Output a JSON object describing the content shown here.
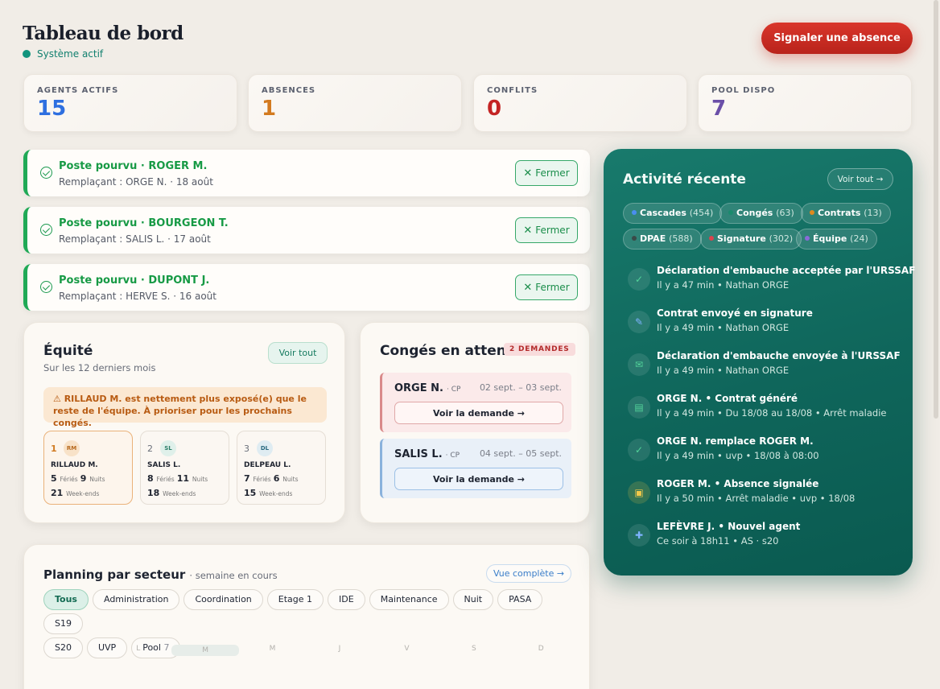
{
  "header": {
    "title": "Tableau de bord",
    "status": "Système actif",
    "report_button": "Signaler une absence"
  },
  "kpis": [
    {
      "label": "AGENTS ACTIFS",
      "value": "15",
      "color": "#2e6fe0"
    },
    {
      "label": "ABSENCES",
      "value": "1",
      "color": "#d37a1f"
    },
    {
      "label": "CONFLITS",
      "value": "0",
      "color": "#c42424"
    },
    {
      "label": "POOL DISPO",
      "value": "7",
      "color": "#6b4fa8"
    }
  ],
  "notifications": [
    {
      "title": "Poste pourvu · ROGER M.",
      "subtitle": "Remplaçant : ORGE N. · 18 août",
      "close": "Fermer"
    },
    {
      "title": "Poste pourvu · BOURGEON T.",
      "subtitle": "Remplaçant : SALIS L. · 17 août",
      "close": "Fermer"
    },
    {
      "title": "Poste pourvu · DUPONT J.",
      "subtitle": "Remplaçant : HERVE S. · 16 août",
      "close": "Fermer"
    }
  ],
  "equity": {
    "title": "Équité",
    "subtitle": "Sur les 12 derniers mois",
    "see_all": "Voir tout",
    "warning": "RILLAUD M. est nettement plus exposé(e) que le reste de l'équipe. À prioriser pour les prochains congés.",
    "labels": {
      "feries": "Fériés",
      "nuits": "Nuits",
      "weekends": "Week-ends"
    },
    "agents": [
      {
        "rank": "1",
        "initials": "RM",
        "name": "RILLAUD M.",
        "feries": "5",
        "nuits": "9",
        "weekends": "21"
      },
      {
        "rank": "2",
        "initials": "SL",
        "name": "SALIS L.",
        "feries": "8",
        "nuits": "11",
        "weekends": "18"
      },
      {
        "rank": "3",
        "initials": "DL",
        "name": "DELPEAU L.",
        "feries": "7",
        "nuits": "6",
        "weekends": "15"
      }
    ]
  },
  "leaves": {
    "title": "Congés en attente",
    "badge": "2 DEMANDES",
    "items": [
      {
        "name": "ORGE N.",
        "type": "· CP",
        "dates": "02 sept. – 03 sept.",
        "button": "Voir la demande →"
      },
      {
        "name": "SALIS L.",
        "type": "· CP",
        "dates": "04 sept. – 05 sept.",
        "button": "Voir la demande →"
      }
    ]
  },
  "planning": {
    "title": "Planning par secteur",
    "subtitle": "· semaine en cours",
    "full_view": "Vue complète →",
    "sectors": [
      "Tous",
      "Administration",
      "Coordination",
      "Etage 1",
      "IDE",
      "Maintenance",
      "Nuit",
      "PASA",
      "S19",
      "S20",
      "UVP",
      "Pool"
    ],
    "pool_count": "7",
    "days": [
      "L",
      "M",
      "M",
      "J",
      "V",
      "S",
      "D"
    ]
  },
  "activity": {
    "title": "Activité récente",
    "see_all": "Voir tout →",
    "filters": [
      {
        "label": "Cascades",
        "count": "(454)",
        "color": "#4a8ef0"
      },
      {
        "label": "Congés",
        "count": "(63)",
        "color": "#1a8b6d"
      },
      {
        "label": "Contrats",
        "count": "(13)",
        "color": "#e08a1e"
      },
      {
        "label": "DPAE",
        "count": "(588)",
        "color": "#3a4a48"
      },
      {
        "label": "Signature",
        "count": "(302)",
        "color": "#d9434d"
      },
      {
        "label": "Équipe",
        "count": "(24)",
        "color": "#8a6ad8"
      }
    ],
    "items": [
      {
        "icon": "check-circle-icon",
        "glyph": "✓",
        "color": "#53d39a",
        "main": "Déclaration d'embauche acceptée par l'URSSAF",
        "meta": "Il y a 47 min • Nathan ORGE"
      },
      {
        "icon": "pen-icon",
        "glyph": "✎",
        "color": "#7eb3ff",
        "main": "Contrat envoyé en signature",
        "meta": "Il y a 49 min • Nathan ORGE"
      },
      {
        "icon": "mail-send-icon",
        "glyph": "✉",
        "color": "#53d39a",
        "main": "Déclaration d'embauche envoyée à l'URSSAF",
        "meta": "Il y a 49 min • Nathan ORGE"
      },
      {
        "icon": "document-icon",
        "glyph": "▤",
        "color": "#53d39a",
        "main": "ORGE N. • Contrat généré",
        "meta": "Il y a 49 min • Du 18/08 au 18/08 • Arrêt maladie"
      },
      {
        "icon": "check-circle-icon",
        "glyph": "✓",
        "color": "#53d39a",
        "main": "ORGE N. remplace ROGER M.",
        "meta": "Il y a 49 min • uvp • 18/08 à 08:00"
      },
      {
        "icon": "alert-badge-icon",
        "glyph": "▣",
        "color": "#f0c84a",
        "main": "ROGER M. • Absence signalée",
        "meta": "Il y a 50 min • Arrêt maladie • uvp • 18/08"
      },
      {
        "icon": "user-plus-icon",
        "glyph": "✚",
        "color": "#7eb3ff",
        "main": "LEFÈVRE J. • Nouvel agent",
        "meta": "Ce soir à 18h11 • AS · s20"
      }
    ]
  }
}
